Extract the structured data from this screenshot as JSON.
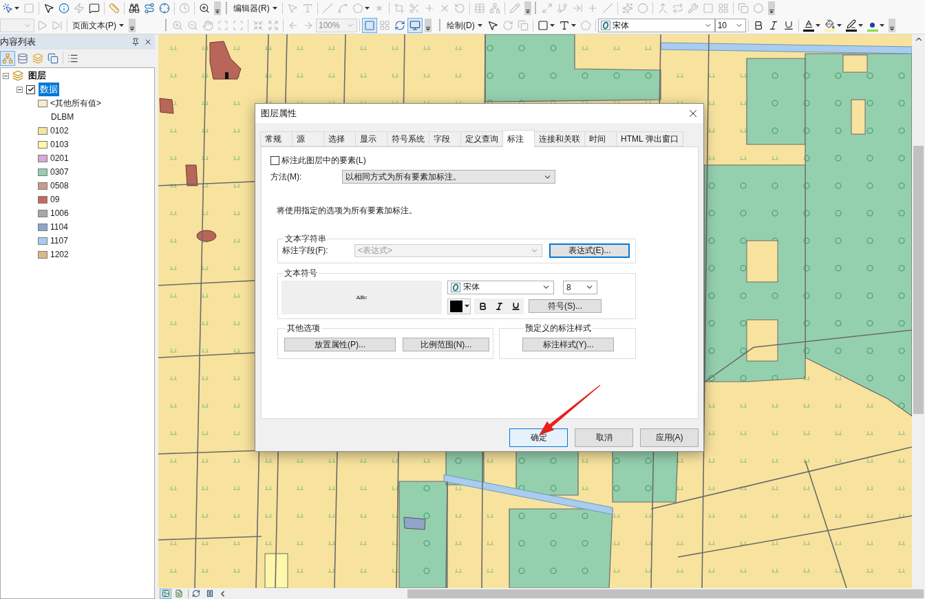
{
  "toolbar_rows": [
    {
      "toolbars": [
        {
          "groups": [
            [
              {
                "kind": "tool",
                "disabled": false,
                "dropdown": true
              },
              {
                "kind": "tool",
                "disabled": true
              }
            ],
            [
              {
                "kind": "tool",
                "disabled": false
              },
              {
                "kind": "tool",
                "disabled": false
              },
              {
                "kind": "tool",
                "disabled": true
              },
              {
                "kind": "tool",
                "disabled": false
              }
            ],
            [
              {
                "kind": "tool",
                "disabled": false
              }
            ],
            [
              {
                "kind": "tool",
                "disabled": false
              },
              {
                "kind": "tool",
                "disabled": false
              },
              {
                "kind": "tool",
                "disabled": false
              }
            ],
            [
              {
                "kind": "tool",
                "disabled": true
              }
            ],
            [
              {
                "kind": "tool",
                "disabled": false
              }
            ]
          ]
        },
        {
          "groups": [
            [
              {
                "kind": "menu",
                "label": "编辑器(R)"
              }
            ],
            [
              {
                "kind": "tool",
                "disabled": true
              },
              {
                "kind": "tool",
                "disabled": true
              }
            ],
            [
              {
                "kind": "tool",
                "disabled": true
              },
              {
                "kind": "tool",
                "disabled": true
              },
              {
                "kind": "tool",
                "disabled": true,
                "dropdown": true
              },
              {
                "kind": "tool",
                "disabled": true
              }
            ],
            [
              {
                "kind": "tool",
                "disabled": true
              },
              {
                "kind": "tool",
                "disabled": true
              },
              {
                "kind": "tool",
                "disabled": true
              },
              {
                "kind": "tool",
                "disabled": true
              },
              {
                "kind": "tool",
                "disabled": true
              }
            ],
            [
              {
                "kind": "tool",
                "disabled": true
              },
              {
                "kind": "tool",
                "disabled": true
              }
            ],
            [
              {
                "kind": "tool",
                "disabled": true
              }
            ]
          ]
        },
        {
          "groups": [
            [
              {
                "kind": "tool",
                "disabled": true
              },
              {
                "kind": "tool",
                "disabled": true
              },
              {
                "kind": "tool",
                "disabled": true
              },
              {
                "kind": "tool",
                "disabled": true
              },
              {
                "kind": "tool",
                "disabled": true
              }
            ],
            [
              {
                "kind": "tool",
                "disabled": true
              },
              {
                "kind": "tool",
                "disabled": true
              }
            ],
            [
              {
                "kind": "tool",
                "disabled": true
              },
              {
                "kind": "tool",
                "disabled": true
              },
              {
                "kind": "tool",
                "disabled": true
              },
              {
                "kind": "tool",
                "disabled": true
              },
              {
                "kind": "tool",
                "disabled": true
              }
            ],
            [
              {
                "kind": "tool",
                "disabled": true
              },
              {
                "kind": "tool",
                "disabled": true
              }
            ]
          ]
        }
      ]
    },
    {
      "toolbars": [
        {
          "groups": [
            [
              {
                "kind": "combo",
                "disabled": true
              },
              {
                "kind": "tool",
                "disabled": true
              },
              {
                "kind": "tool",
                "disabled": true
              }
            ],
            [
              {
                "kind": "menu",
                "label": "页面文本(P)"
              }
            ]
          ]
        },
        {
          "groups": [
            [
              {
                "kind": "tool",
                "disabled": true
              },
              {
                "kind": "tool",
                "disabled": true
              },
              {
                "kind": "tool",
                "disabled": true
              },
              {
                "kind": "tool",
                "disabled": true
              },
              {
                "kind": "tool",
                "disabled": true
              }
            ],
            [
              {
                "kind": "tool",
                "disabled": true
              },
              {
                "kind": "tool",
                "disabled": true
              }
            ],
            [
              {
                "kind": "tool",
                "disabled": true
              },
              {
                "kind": "tool",
                "disabled": true
              },
              {
                "kind": "combo",
                "value": "100%",
                "disabled": true
              }
            ],
            [
              {
                "kind": "tool",
                "disabled": false,
                "selected": true
              },
              {
                "kind": "tool",
                "disabled": true,
                "selected": false
              },
              {
                "kind": "tool",
                "disabled": false,
                "selected": false
              },
              {
                "kind": "tool",
                "disabled": false,
                "selected": true
              }
            ]
          ]
        },
        {
          "groups": [
            [
              {
                "kind": "menu",
                "label": "绘制(D)"
              },
              {
                "kind": "tool",
                "disabled": false
              },
              {
                "kind": "tool",
                "disabled": true
              },
              {
                "kind": "tool",
                "disabled": true
              }
            ],
            [
              {
                "kind": "tool",
                "disabled": false,
                "dropdown": true
              },
              {
                "kind": "tool",
                "disabled": false,
                "dropdown": true
              },
              {
                "kind": "tool",
                "disabled": true
              }
            ],
            [
              {
                "kind": "fontcombo",
                "value": "宋体"
              },
              {
                "kind": "sizecombo",
                "value": "10"
              }
            ],
            [
              {
                "kind": "tool",
                "disabled": false
              },
              {
                "kind": "tool",
                "disabled": false
              },
              {
                "kind": "tool",
                "disabled": false
              }
            ],
            [
              {
                "kind": "color",
                "color": "#000000"
              },
              {
                "kind": "color",
                "color": "#fff2a8"
              },
              {
                "kind": "color",
                "color": "#000000"
              },
              {
                "kind": "color",
                "color": "#7ee040"
              }
            ]
          ]
        }
      ]
    }
  ],
  "contents_panel": {
    "title": "内容列表",
    "tools": [
      {
        "selected": true
      },
      {
        "selected": false
      },
      {
        "selected": false
      },
      {
        "selected": false
      },
      {
        "selected": false
      }
    ],
    "tree": [
      {
        "label": "图层",
        "expanded": true,
        "children": [
          {
            "label": "数据",
            "expanded": true,
            "checked": true,
            "selected": true,
            "legend": [
              {
                "kind": "class",
                "label": "<其他所有值>",
                "color": "#f6ecc6"
              },
              {
                "kind": "field",
                "label": "DLBM"
              },
              {
                "kind": "class",
                "label": "0102",
                "color": "#f6e39c"
              },
              {
                "kind": "class",
                "label": "0103",
                "color": "#fff8a8"
              },
              {
                "kind": "class",
                "label": "0201",
                "color": "#d8a8d8"
              },
              {
                "kind": "class",
                "label": "0307",
                "color": "#93cfae"
              },
              {
                "kind": "class",
                "label": "0508",
                "color": "#c99a8c"
              },
              {
                "kind": "class",
                "label": "09",
                "color": "#c56b5a"
              },
              {
                "kind": "class",
                "label": "1006",
                "color": "#a8a8a8"
              },
              {
                "kind": "class",
                "label": "1104",
                "color": "#8fa4c8"
              },
              {
                "kind": "class",
                "label": "1107",
                "color": "#a9cdef"
              },
              {
                "kind": "class",
                "label": "1202",
                "color": "#ddb887"
              }
            ]
          }
        ]
      }
    ]
  },
  "map_view": {
    "view_buttons": [
      {
        "selected": true
      },
      {
        "selected": false
      }
    ]
  },
  "dialog": {
    "title": "图层属性",
    "tabs": [
      {
        "label": "常规",
        "selected": false
      },
      {
        "label": "源",
        "selected": false
      },
      {
        "label": "选择",
        "selected": false
      },
      {
        "label": "显示",
        "selected": false
      },
      {
        "label": "符号系统",
        "selected": false
      },
      {
        "label": "字段",
        "selected": false
      },
      {
        "label": "定义查询",
        "selected": false
      },
      {
        "label": "标注",
        "selected": true
      },
      {
        "label": "连接和关联",
        "selected": false
      },
      {
        "label": "时间",
        "selected": false
      },
      {
        "label": "HTML 弹出窗口",
        "selected": false
      }
    ],
    "label_checkbox": {
      "label": "标注此图层中的要素(L)",
      "checked": false
    },
    "method": {
      "label": "方法(M):",
      "value": "以相同方式为所有要素加标注。"
    },
    "description": "将使用指定的选项为所有要素加标注。",
    "text_string": {
      "title": "文本字符串",
      "field_label": "标注字段(F):",
      "field_value": "<表达式>",
      "field_disabled": true,
      "expression_button": {
        "label": "表达式(E)...",
        "focused": true
      }
    },
    "text_symbol": {
      "title": "文本符号",
      "preview": "ABc",
      "font": "宋体",
      "size": "8",
      "color": "#000000",
      "bold": false,
      "italic": false,
      "underline": false,
      "symbol_button": "符号(S)..."
    },
    "other_options": {
      "title": "其他选项",
      "buttons": [
        "放置属性(P)...",
        "比例范围(N)..."
      ]
    },
    "predefined_styles": {
      "title": "预定义的标注样式",
      "button": "标注样式(Y)..."
    },
    "footer_buttons": [
      {
        "label": "确定",
        "default": true
      },
      {
        "label": "取消",
        "default": false
      },
      {
        "label": "应用(A)",
        "default": false
      }
    ]
  }
}
